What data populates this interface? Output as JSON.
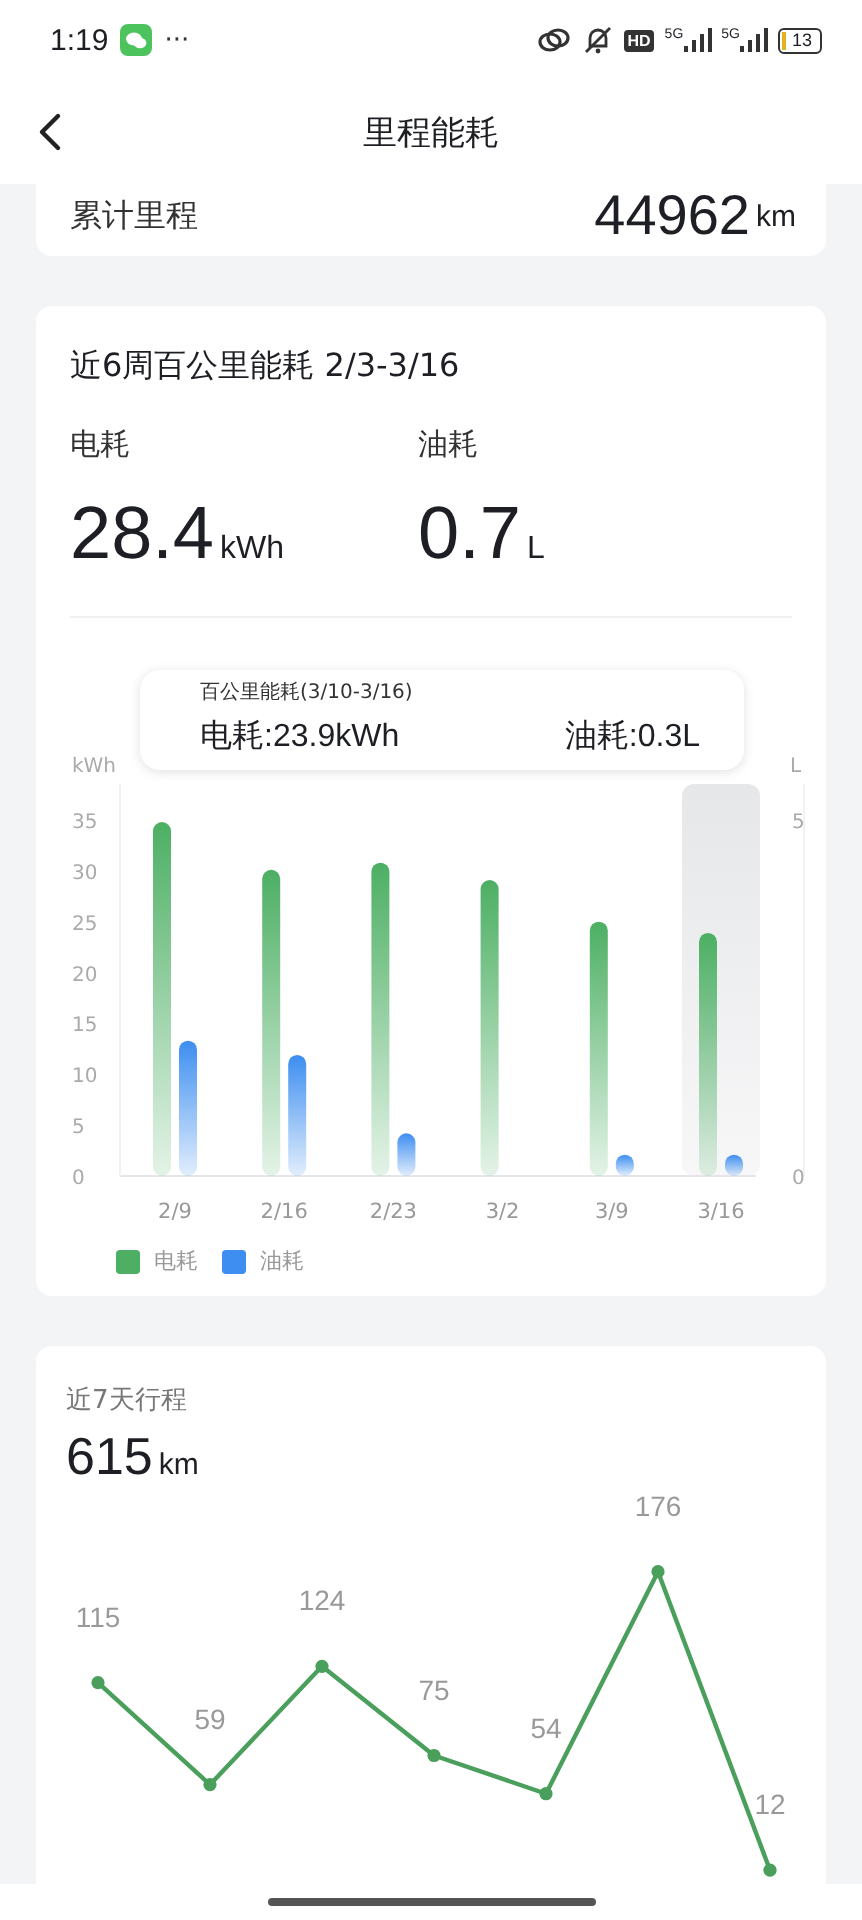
{
  "status_bar": {
    "time": "1:19",
    "more": "···",
    "hd_badge": "HD",
    "signals": [
      {
        "label": "5G"
      },
      {
        "label": "5G"
      }
    ],
    "battery": "13"
  },
  "nav": {
    "title": "里程能耗"
  },
  "total_mileage": {
    "label": "累计里程",
    "value": "44962",
    "unit": "km"
  },
  "consumption": {
    "title": "近6周百公里能耗 2/3-3/16",
    "stats": [
      {
        "label": "电耗",
        "value": "28.4",
        "unit": "kWh"
      },
      {
        "label": "油耗",
        "value": "0.7",
        "unit": "L"
      }
    ],
    "tooltip": {
      "title": "百公里能耗(3/10-3/16)",
      "items": [
        "电耗:23.9kWh",
        "油耗:0.3L"
      ]
    },
    "chart_data": {
      "type": "bar",
      "ylabel": "kWh",
      "y2label": "L",
      "categories": [
        "2/9",
        "2/16",
        "2/23",
        "3/2",
        "3/9",
        "3/16"
      ],
      "ylim": [
        0,
        35
      ],
      "yticks": [
        0,
        5,
        10,
        15,
        20,
        25,
        30,
        35
      ],
      "y2lim": [
        0,
        5
      ],
      "y2ticks": [
        0,
        5
      ],
      "series": [
        {
          "name": "电耗",
          "color": "#4caf63",
          "values": [
            34.8,
            30.1,
            30.8,
            29.1,
            25,
            23.9
          ]
        },
        {
          "name": "油耗",
          "color": "#3d8ef0",
          "axis": "y2",
          "values": [
            1.9,
            1.7,
            0.6,
            null,
            0.3,
            0.3
          ]
        }
      ]
    },
    "columns": [
      {
        "selected": false
      },
      {
        "selected": false
      },
      {
        "selected": false
      },
      {
        "selected": false
      },
      {
        "selected": false
      },
      {
        "selected": true
      }
    ]
  },
  "trips": {
    "title": "近7天行程",
    "value": "615",
    "unit": "km",
    "chart_data": {
      "type": "line",
      "data_labels": true,
      "series": [
        {
          "color": "#4a9f5c",
          "marker": "circle",
          "values": [
            115,
            59,
            124,
            75,
            54,
            176,
            12
          ]
        }
      ]
    }
  }
}
